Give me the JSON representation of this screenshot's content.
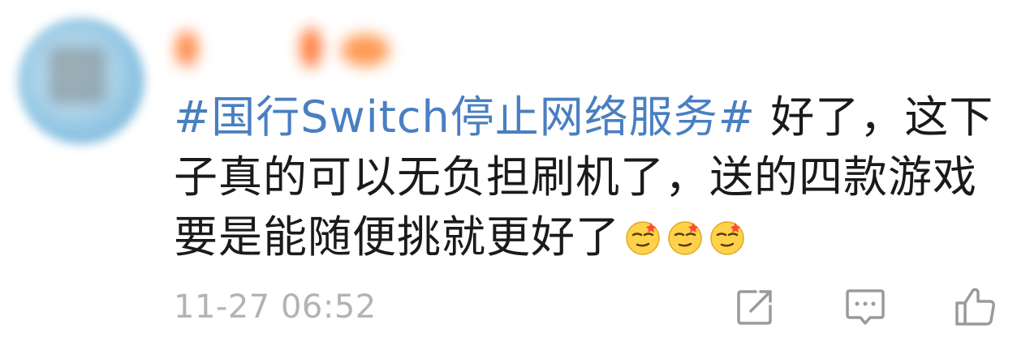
{
  "comment": {
    "topic": "#国行Switch停止网络服务#",
    "text": " 好了，这下子真的可以无负担刷机了，送的四款游戏要是能随便挑就更好了",
    "emojis": [
      "smirk-emoji",
      "smirk-emoji",
      "smirk-emoji"
    ],
    "timestamp": "11-27 06:52"
  },
  "actions": {
    "share_icon": "share-icon",
    "comment_icon": "comment-icon",
    "like_icon": "thumbs-up-icon"
  },
  "colors": {
    "topic": "#4a7fc1",
    "text": "#1a1a1a",
    "meta": "#b3b3b3",
    "icon": "#9a9a9a"
  }
}
